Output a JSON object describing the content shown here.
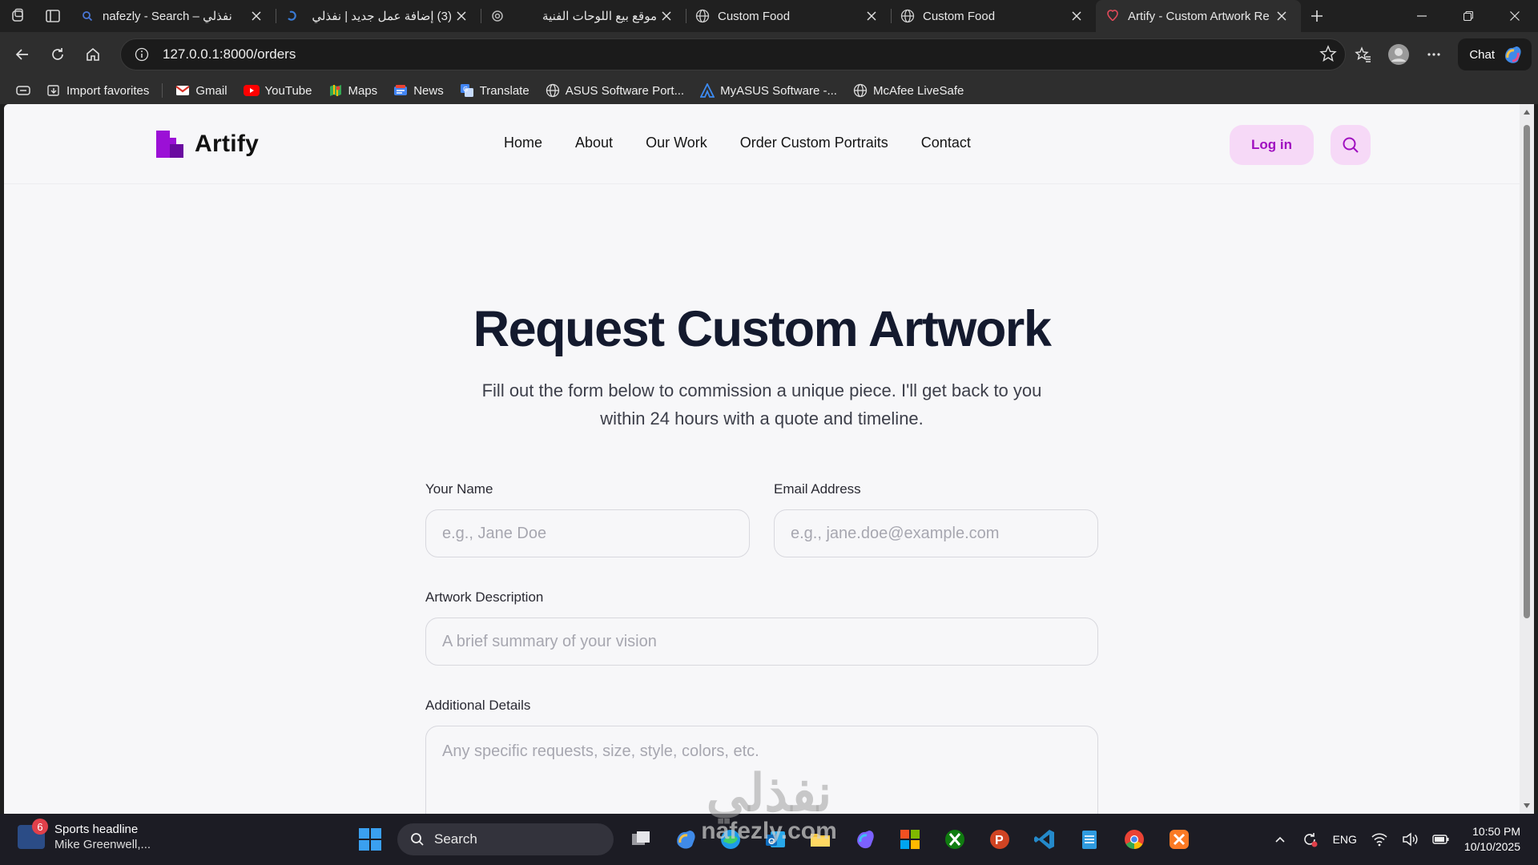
{
  "browser": {
    "tabs": [
      {
        "title": "nafezly - Search – نفذلي",
        "rtl": false,
        "active": false
      },
      {
        "title": "(3) إضافة عمل جديد | نفذلي",
        "rtl": true,
        "active": false
      },
      {
        "title": "موقع بيع اللوحات الفنية",
        "rtl": true,
        "active": false
      },
      {
        "title": "Custom Food",
        "rtl": false,
        "active": false
      },
      {
        "title": "Custom Food",
        "rtl": false,
        "active": false
      },
      {
        "title": "Artify - Custom Artwork Re",
        "rtl": false,
        "active": true
      }
    ],
    "url": "127.0.0.1:8000/orders",
    "chat_label": "Chat",
    "favorites": [
      {
        "label": "Import favorites",
        "icon": "import-icon"
      },
      {
        "label": "Gmail",
        "icon": "gmail-icon"
      },
      {
        "label": "YouTube",
        "icon": "youtube-icon"
      },
      {
        "label": "Maps",
        "icon": "maps-icon"
      },
      {
        "label": "News",
        "icon": "news-icon"
      },
      {
        "label": "Translate",
        "icon": "translate-icon"
      },
      {
        "label": "ASUS Software Port...",
        "icon": "globe-icon"
      },
      {
        "label": "MyASUS Software -...",
        "icon": "myasus-icon"
      },
      {
        "label": "McAfee LiveSafe",
        "icon": "globe-icon"
      }
    ]
  },
  "site": {
    "brand": "Artify",
    "brand_color": "#9b10d6",
    "nav": [
      "Home",
      "About",
      "Our Work",
      "Order Custom Portraits",
      "Contact"
    ],
    "login_label": "Log in",
    "hero": {
      "title": "Request Custom Artwork",
      "subtitle": "Fill out the form below to commission a unique piece. I'll get back to you within 24 hours with a quote and timeline."
    },
    "form": {
      "name_label": "Your Name",
      "name_placeholder": "e.g., Jane Doe",
      "email_label": "Email Address",
      "email_placeholder": "e.g., jane.doe@example.com",
      "description_label": "Artwork Description",
      "description_placeholder": "A brief summary of your vision",
      "details_label": "Additional Details",
      "details_placeholder": "Any specific requests, size, style, colors, etc."
    },
    "watermark": {
      "arabic": "نفذلي",
      "latin": "nafezly.com"
    }
  },
  "taskbar": {
    "news_title": "Sports headline",
    "news_sub": "Mike Greenwell,...",
    "news_badge": "6",
    "search_label": "Search",
    "language": "ENG",
    "time": "10:50 PM",
    "date": "10/10/2025"
  }
}
